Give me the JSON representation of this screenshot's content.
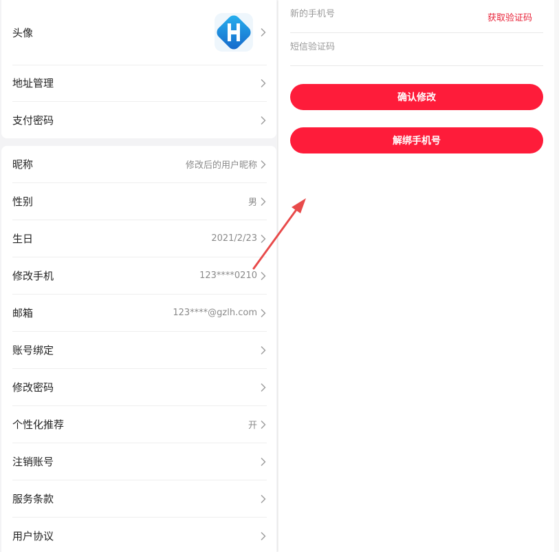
{
  "settings_group1": [
    {
      "label": "头像",
      "value": "",
      "icon": "app-logo-icon"
    },
    {
      "label": "地址管理",
      "value": ""
    },
    {
      "label": "支付密码",
      "value": ""
    }
  ],
  "settings_group2": [
    {
      "label": "昵称",
      "value": "修改后的用户昵称"
    },
    {
      "label": "性别",
      "value": "男"
    },
    {
      "label": "生日",
      "value": "2021/2/23"
    },
    {
      "label": "修改手机",
      "value": "123****0210"
    },
    {
      "label": "邮箱",
      "value": "123****@gzlh.com"
    },
    {
      "label": "账号绑定",
      "value": ""
    },
    {
      "label": "修改密码",
      "value": ""
    },
    {
      "label": "个性化推荐",
      "value": "开"
    },
    {
      "label": "注销账号",
      "value": ""
    },
    {
      "label": "服务条款",
      "value": ""
    },
    {
      "label": "用户协议",
      "value": ""
    }
  ],
  "phone_form": {
    "new_phone_placeholder": "新的手机号",
    "sms_code_placeholder": "短信验证码",
    "get_code_label": "获取验证码",
    "confirm_label": "确认修改",
    "unbind_label": "解绑手机号"
  },
  "colors": {
    "accent": "#fe1c3a",
    "link": "#e8243a",
    "annotation_arrow": "#e84a4a"
  }
}
